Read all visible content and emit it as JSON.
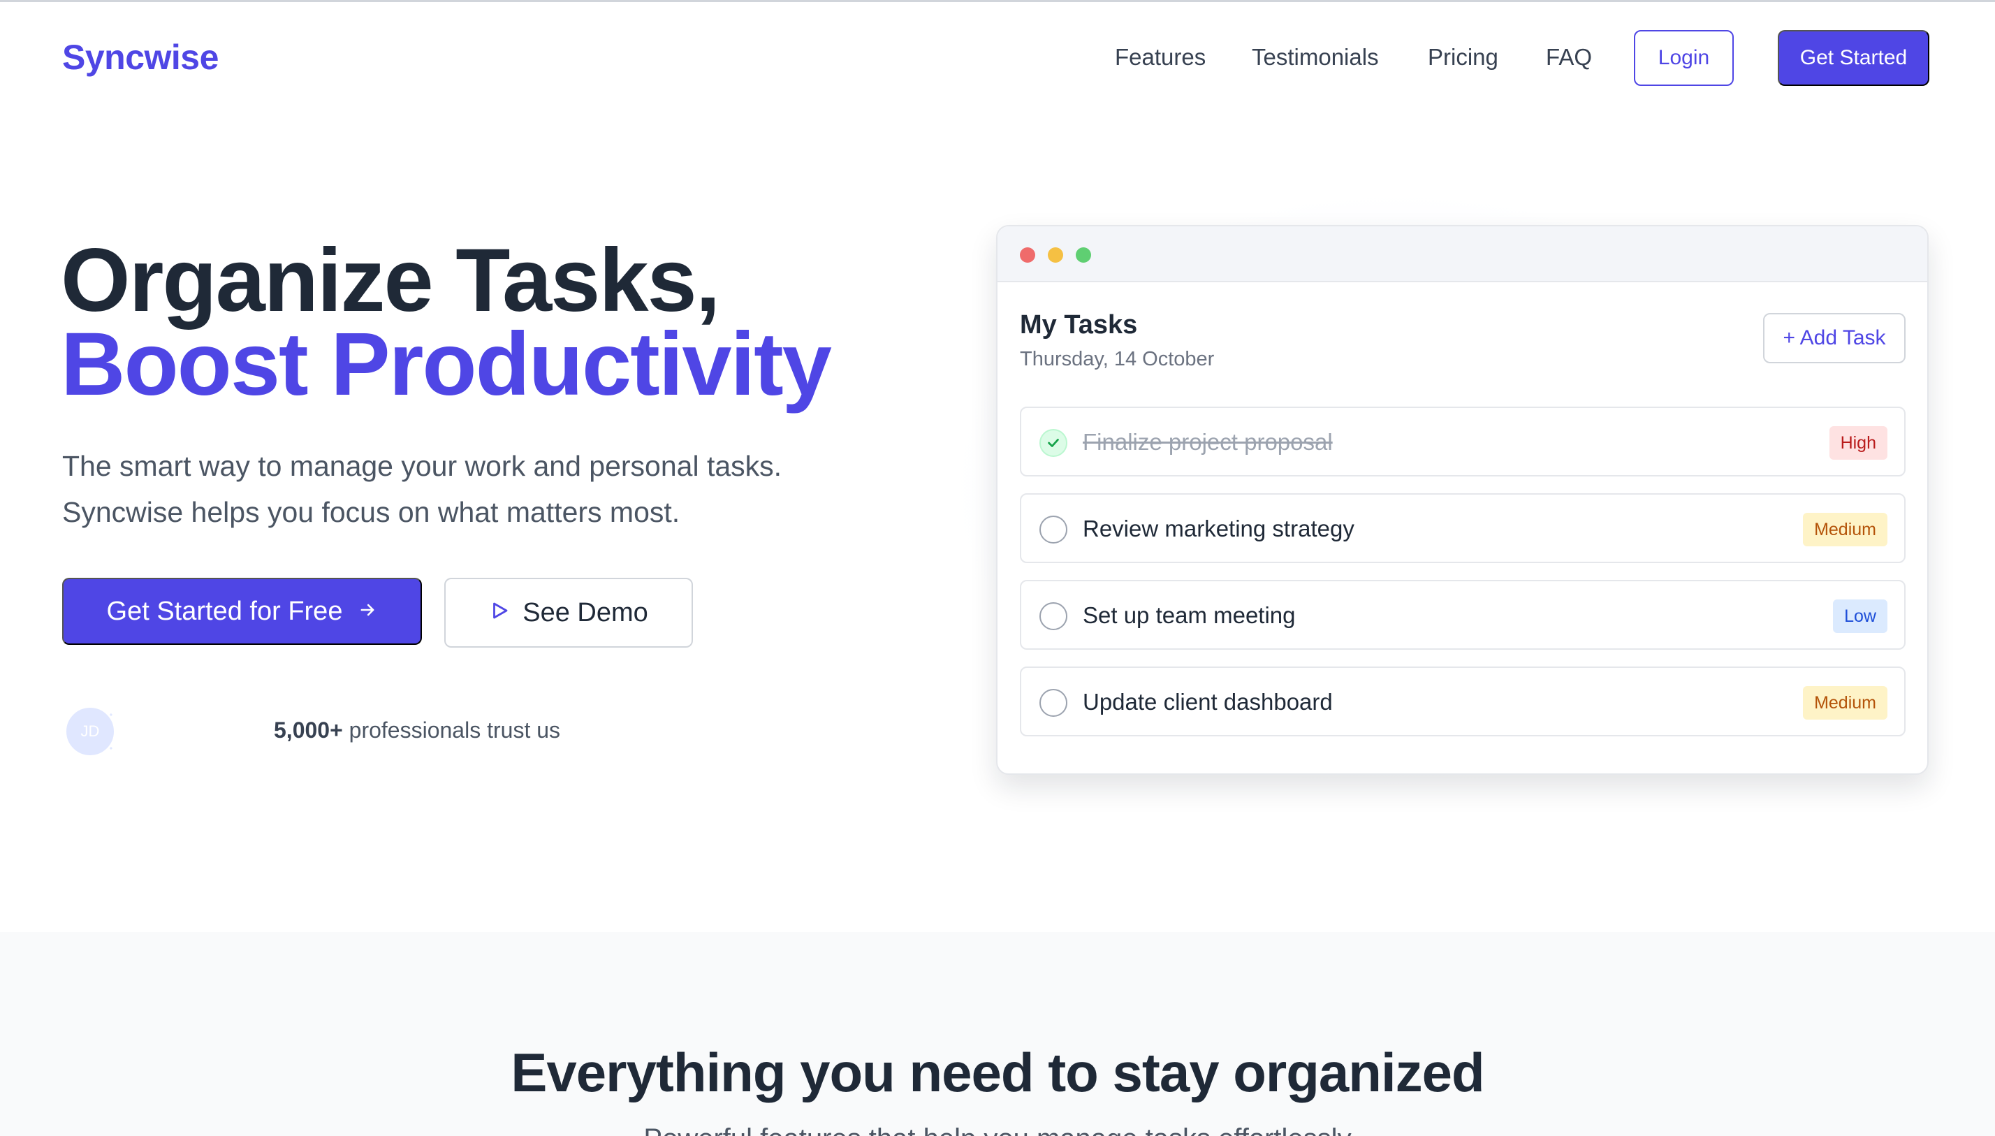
{
  "nav": {
    "logo": "Syncwise",
    "links": [
      "Features",
      "Testimonials",
      "Pricing",
      "FAQ"
    ],
    "login_label": "Login",
    "get_started_label": "Get Started"
  },
  "hero": {
    "title_line1": "Organize Tasks,",
    "title_line2": "Boost Productivity",
    "subtitle_line1": "The smart way to manage your work and personal tasks.",
    "subtitle_line2": "Syncwise helps you focus on what matters most.",
    "cta_primary": "Get Started for Free",
    "cta_secondary": "See Demo",
    "avatar_initials": "JD",
    "trust_count": "5,000+",
    "trust_text": " professionals trust us"
  },
  "app": {
    "title": "My Tasks",
    "date": "Thursday, 14 October",
    "add_task_label": "+ Add Task",
    "tasks": [
      {
        "label": "Finalize project proposal",
        "priority": "High",
        "done": true
      },
      {
        "label": "Review marketing strategy",
        "priority": "Medium",
        "done": false
      },
      {
        "label": "Set up team meeting",
        "priority": "Low",
        "done": false
      },
      {
        "label": "Update client dashboard",
        "priority": "Medium",
        "done": false
      }
    ],
    "priority_colors": {
      "High": {
        "bg": "#fee2e2",
        "fg": "#b91c1c"
      },
      "Medium": {
        "bg": "#fef3c7",
        "fg": "#b45309"
      },
      "Low": {
        "bg": "#dbeafe",
        "fg": "#1d4ed8"
      }
    },
    "window_dots": [
      "#ef6b6b",
      "#f5c043",
      "#5fcf72"
    ]
  },
  "features": {
    "title": "Everything you need to stay organized",
    "subtitle": "Powerful features that help you manage tasks effortlessly"
  },
  "colors": {
    "brand": "#4f46e5",
    "text": "#1f2937"
  }
}
